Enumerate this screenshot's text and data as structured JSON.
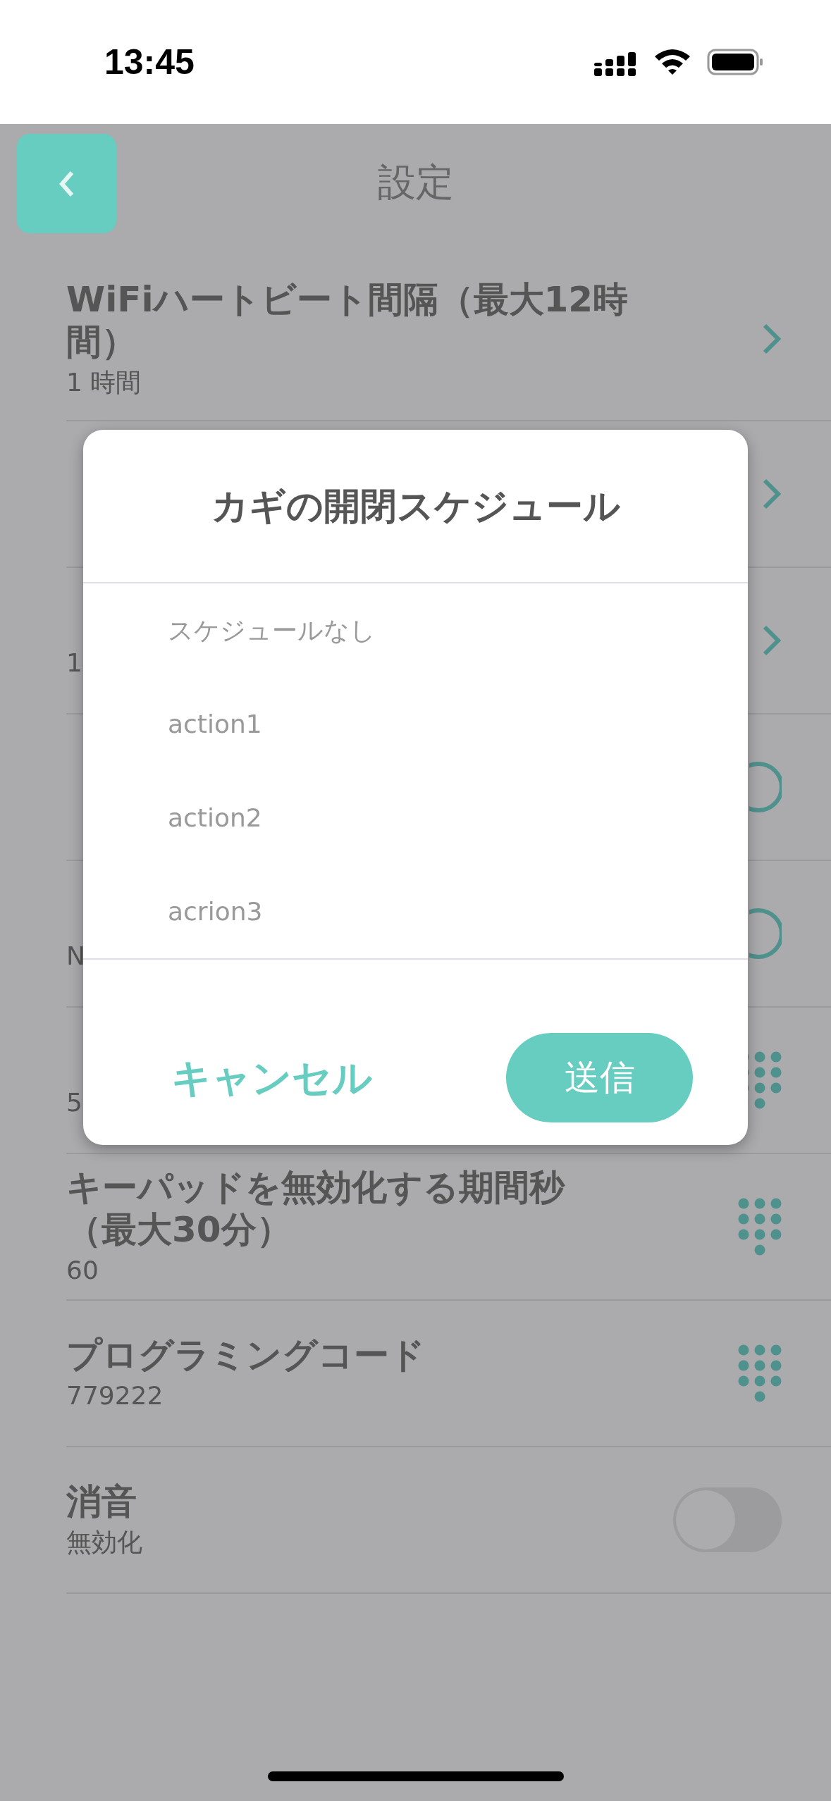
{
  "status_bar": {
    "time": "13:45"
  },
  "header": {
    "title": "設定"
  },
  "settings": [
    {
      "title": "WiFiハートビート間隔（最大12時間）",
      "value": "1 時間",
      "kind": "chevron"
    },
    {
      "kind": "chevron"
    },
    {
      "value": "1",
      "kind": "chevron"
    },
    {
      "kind": "circle"
    },
    {
      "value": "N",
      "kind": "circle"
    },
    {
      "value": "5",
      "kind": "keypad"
    },
    {
      "title": "キーパッドを無効化する期間秒（最大30分）",
      "value": "60",
      "kind": "keypad"
    },
    {
      "title": "プログラミングコード",
      "value": "779222",
      "kind": "keypad"
    },
    {
      "title": "消音",
      "value": "無効化",
      "kind": "toggle",
      "on": false
    }
  ],
  "dialog": {
    "title": "カギの開閉スケジュール",
    "options": [
      {
        "label": "スケジュールなし",
        "selected": false
      },
      {
        "label": "action1",
        "selected": false
      },
      {
        "label": "action2",
        "selected": false
      },
      {
        "label": "acrion3",
        "selected": false
      }
    ],
    "cancel": "キャンセル",
    "submit": "送信"
  }
}
